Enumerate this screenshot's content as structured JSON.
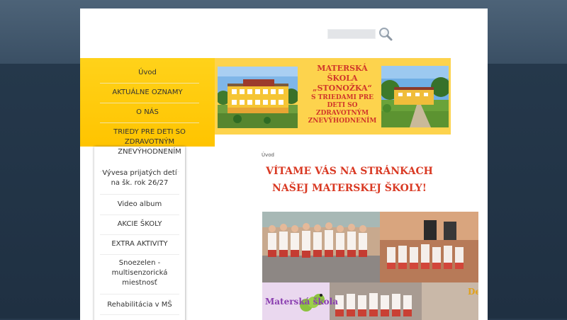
{
  "search": {
    "placeholder": "",
    "icon": "magnifier-icon"
  },
  "nav": {
    "primary": [
      "Úvod",
      "AKTUÁLNE OZNAMY",
      "O NÁS",
      "TRIEDY PRE DETI SO ZDRAVOTNÝM ZNEVÝHODNENÍM"
    ],
    "secondary": [
      "Vývesa prijatých detí na šk. rok 26/27",
      "Video album",
      "AKCIE ŠKOLY",
      "EXTRA AKTIVITY",
      "Snoezelen - multisenzorická miestnosť",
      "Rehabilitácia v MŠ"
    ]
  },
  "banner": {
    "title_line1": "MATERSKÁ ŠKOLA „STONOŽKA“",
    "title_line2": "S TRIEDAMI PRE DETI SO ZDRAVOTNÝM ZNEVÝHODNENÍM"
  },
  "main": {
    "breadcrumb": "Úvod",
    "headline": "VÍTAME VÁS NA STRÁNKACH NAŠEJ MATERSKEJ ŠKOLY!",
    "collage_label": "Materská škola",
    "collage_label_right": "De"
  },
  "colors": {
    "accent_yellow": "#ffc400",
    "headline_red": "#d93a24",
    "page_bg": "#27394c"
  }
}
